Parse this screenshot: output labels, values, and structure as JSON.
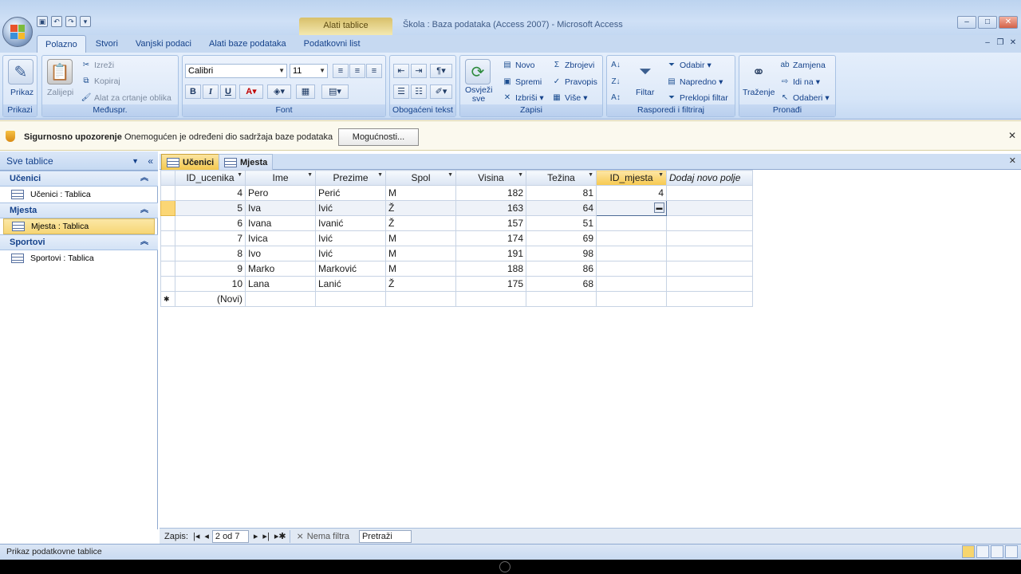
{
  "window": {
    "title": "Škola : Baza podataka (Access 2007) - Microsoft Access",
    "context_tab": "Alati tablice"
  },
  "ribbon": {
    "tabs": [
      "Polazno",
      "Stvori",
      "Vanjski podaci",
      "Alati baze podataka",
      "Podatkovni list"
    ],
    "active_tab": "Polazno",
    "groups": {
      "prikazi": {
        "label": "Prikazi",
        "view": "Prikaz"
      },
      "medjuspr": {
        "label": "Međuspr.",
        "paste": "Zalijepi",
        "cut": "Izreži",
        "copy": "Kopiraj",
        "format_painter": "Alat za crtanje oblika"
      },
      "font": {
        "label": "Font",
        "font_name": "Calibri",
        "font_size": "11",
        "bold": "B",
        "italic": "I",
        "underline": "U"
      },
      "obogaceni": {
        "label": "Obogaćeni tekst"
      },
      "zapisi": {
        "label": "Zapisi",
        "refresh": "Osvježi sve",
        "new": "Novo",
        "save": "Spremi",
        "delete": "Izbriši",
        "totals": "Zbrojevi",
        "spelling": "Pravopis",
        "more": "Više"
      },
      "sort_filter": {
        "label": "Rasporedi i filtriraj",
        "filter": "Filtar",
        "selection": "Odabir",
        "advanced": "Napredno",
        "toggle": "Preklopi filtar"
      },
      "find": {
        "label": "Pronađi",
        "find": "Traženje",
        "replace": "Zamjena",
        "goto": "Idi na",
        "select": "Odaberi"
      }
    }
  },
  "security": {
    "title": "Sigurnosno upozorenje",
    "message": "Onemogućen je određeni dio sadržaja baze podataka",
    "button": "Mogućnosti..."
  },
  "nav_pane": {
    "header": "Sve tablice",
    "groups": [
      {
        "name": "Učenici",
        "items": [
          "Učenici : Tablica"
        ]
      },
      {
        "name": "Mjesta",
        "items": [
          "Mjesta : Tablica"
        ]
      },
      {
        "name": "Sportovi",
        "items": [
          "Sportovi : Tablica"
        ]
      }
    ]
  },
  "doc_tabs": [
    "Učenici",
    "Mjesta"
  ],
  "table": {
    "columns": [
      "ID_ucenika",
      "Ime",
      "Prezime",
      "Spol",
      "Visina",
      "Težina",
      "ID_mjesta",
      "Dodaj novo polje"
    ],
    "rows": [
      [
        "4",
        "Pero",
        "Perić",
        "M",
        "182",
        "81",
        "4"
      ],
      [
        "5",
        "Iva",
        "Ivić",
        "Ž",
        "163",
        "64",
        ""
      ],
      [
        "6",
        "Ivana",
        "Ivanić",
        "Ž",
        "157",
        "51",
        ""
      ],
      [
        "7",
        "Ivica",
        "Ivić",
        "M",
        "174",
        "69",
        ""
      ],
      [
        "8",
        "Ivo",
        "Ivić",
        "M",
        "191",
        "98",
        ""
      ],
      [
        "9",
        "Marko",
        "Marković",
        "M",
        "188",
        "86",
        ""
      ],
      [
        "10",
        "Lana",
        "Lanić",
        "Ž",
        "175",
        "68",
        ""
      ]
    ],
    "new_row_label": "(Novi)"
  },
  "record_nav": {
    "label": "Zapis:",
    "position": "2 od 7",
    "filter": "Nema filtra",
    "search": "Pretraži"
  },
  "status": {
    "text": "Prikaz podatkovne tablice"
  }
}
